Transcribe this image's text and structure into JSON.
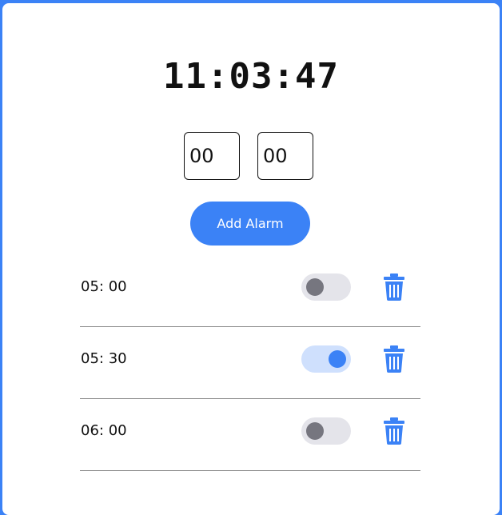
{
  "clock": {
    "time": "11:03:47"
  },
  "inputs": {
    "hours": "00",
    "minutes": "00"
  },
  "add_button": {
    "label": "Add Alarm"
  },
  "alarms": [
    {
      "time": "05: 00",
      "enabled": false
    },
    {
      "time": "05: 30",
      "enabled": true
    },
    {
      "time": "06: 00",
      "enabled": false
    }
  ],
  "colors": {
    "accent": "#3b82f6",
    "toggle_off_track": "#e4e4ea",
    "toggle_off_knob": "#76767f",
    "toggle_on_track": "#cfe0fd"
  },
  "icons": {
    "delete": "trash-icon"
  }
}
